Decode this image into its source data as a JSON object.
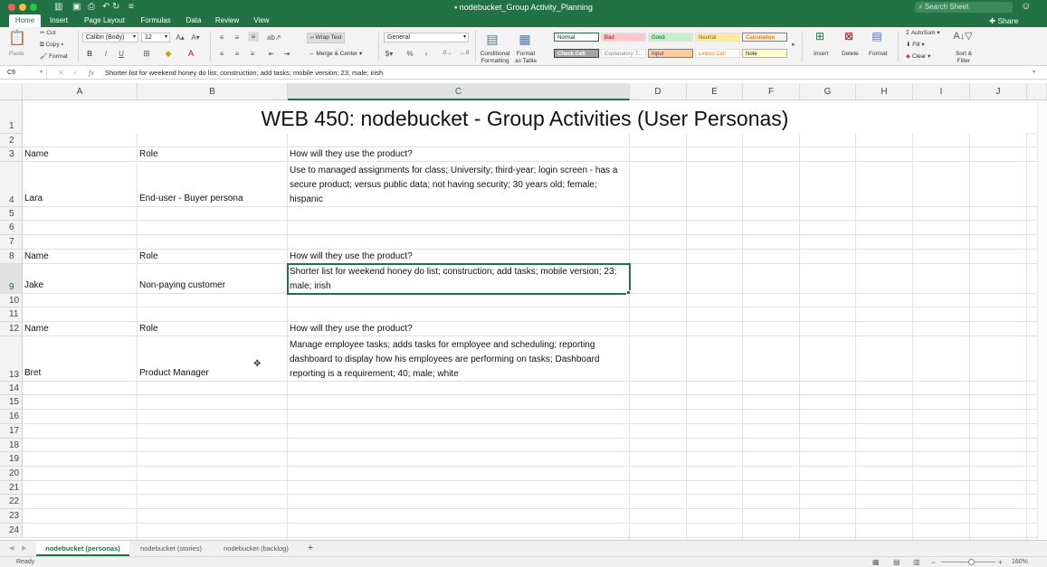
{
  "app": {
    "doc_title": "nodebucket_Group Activity_Planning",
    "search_placeholder": "Search Sheet",
    "share_label": "Share"
  },
  "ribbon_tabs": [
    "Home",
    "Insert",
    "Page Layout",
    "Formulas",
    "Data",
    "Review",
    "View"
  ],
  "ribbon": {
    "paste": "Paste",
    "cut": "Cut",
    "copy": "Copy",
    "format_painter": "Format",
    "font_name": "Calibri (Body)",
    "font_size": "12",
    "wrap_text": "Wrap Text",
    "merge_center": "Merge & Center",
    "number_format": "General",
    "conditional_formatting_1": "Conditional",
    "conditional_formatting_2": "Formatting",
    "format_as_table_1": "Format",
    "format_as_table_2": "as Table",
    "styles": [
      "Normal",
      "Bad",
      "Good",
      "Neutral",
      "Calculation",
      "Check Cell",
      "Explanatory T...",
      "Input",
      "Linked Cell",
      "Note"
    ],
    "insert": "Insert",
    "delete": "Delete",
    "format": "Format",
    "autosum": "AutoSum",
    "fill": "Fill",
    "clear": "Clear",
    "sort_filter_1": "Sort &",
    "sort_filter_2": "Filter"
  },
  "formula_bar": {
    "name_box": "C9",
    "fx": "fx",
    "content": "Shorter list for weekend honey do list; construction; add tasks; mobile version; 23; male; irish"
  },
  "columns": [
    "A",
    "B",
    "C",
    "D",
    "E",
    "F",
    "G",
    "H",
    "I",
    "J"
  ],
  "rows": [
    "1",
    "2",
    "3",
    "4",
    "5",
    "6",
    "7",
    "8",
    "9",
    "10",
    "11",
    "12",
    "13",
    "14",
    "15",
    "16",
    "17",
    "18",
    "19",
    "20",
    "21",
    "22",
    "23",
    "24"
  ],
  "sheet": {
    "title": "WEB 450: nodebucket - Group Activities (User Personas)",
    "h3": {
      "a": "Name",
      "b": "Role",
      "c": "How will they use the product?"
    },
    "r4": {
      "a": "Lara",
      "b": "End-user - Buyer persona",
      "c": "Use to managed assignments for class; University; third-year; login screen - has a secure product; versus public data; not having security; 30 years old; female; hispanic"
    },
    "h8": {
      "a": "Name",
      "b": "Role",
      "c": "How will they use the product?"
    },
    "r9": {
      "a": "Jake",
      "b": "Non-paying customer",
      "c": "Shorter list for weekend honey do list; construction; add tasks; mobile version; 23; male; irish"
    },
    "h12": {
      "a": "Name",
      "b": "Role",
      "c": "How will they use the product?"
    },
    "r13": {
      "a": "Bret",
      "b": "Product Manager",
      "c": "Manage employee tasks; adds tasks for employee and scheduling; reporting dashboard to display how his employees are performing on tasks; Dashboard reporting is a requirement; 40; male; white"
    }
  },
  "sheet_tabs": [
    "nodebucket (personas)",
    "nodebucket (stories)",
    "nodebucket (backlog)"
  ],
  "status": {
    "ready": "Ready",
    "zoom": "160%"
  },
  "colors": {
    "accent": "#217346"
  }
}
